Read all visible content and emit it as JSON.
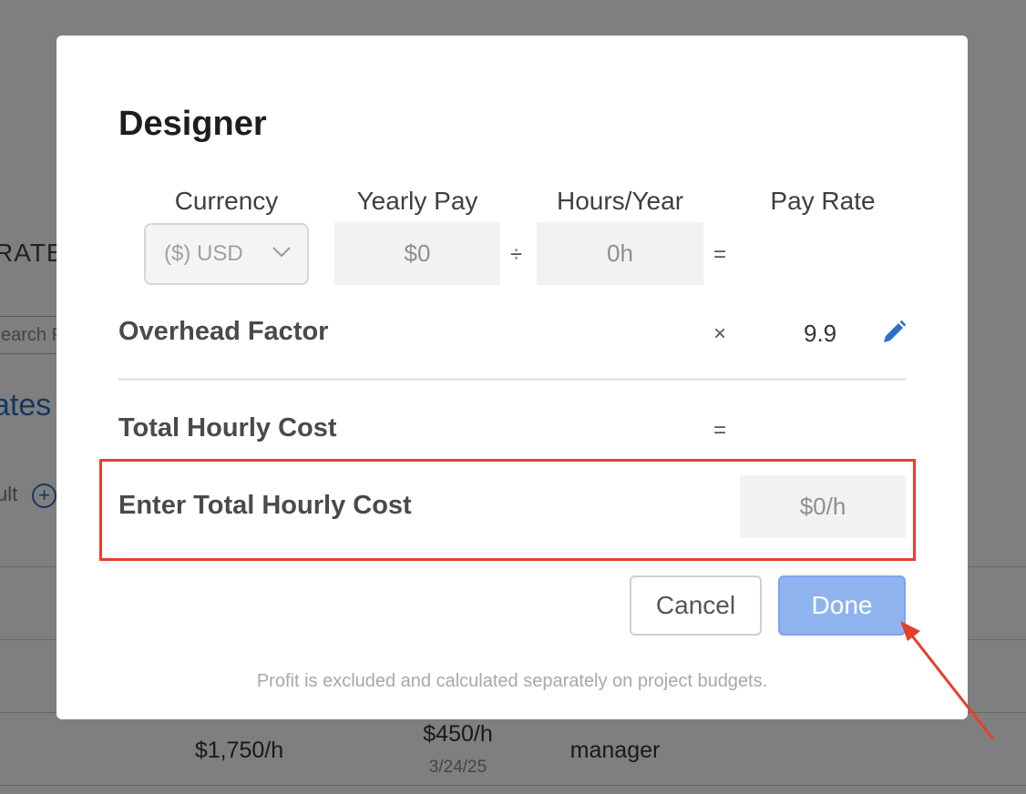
{
  "background": {
    "section_fragment": "RATE",
    "search_fragment": "earch F",
    "rates_link_fragment": "ates",
    "default_fragment": "ult",
    "table_row": {
      "rate": "$1,750/h",
      "cost": "$450/h",
      "cost_date": "3/24/25",
      "role": "manager"
    }
  },
  "modal": {
    "title": "Designer",
    "columns": {
      "currency": "Currency",
      "yearly_pay": "Yearly Pay",
      "hours_year": "Hours/Year",
      "pay_rate": "Pay Rate"
    },
    "currency_value": "($) USD",
    "yearly_pay_value": "$0",
    "hours_year_value": "0h",
    "divide_symbol": "÷",
    "equals_symbol": "=",
    "times_symbol": "×",
    "overhead_label": "Overhead Factor",
    "overhead_value": "9.9",
    "total_label": "Total Hourly Cost",
    "enter_total_label": "Enter Total Hourly Cost",
    "enter_total_placeholder": "$0/h",
    "cancel_label": "Cancel",
    "done_label": "Done",
    "footnote": "Profit is excluded and calculated separately on project budgets."
  },
  "colors": {
    "accent_blue": "#2d6fc4",
    "done_button": "#8fb3ef",
    "highlight_red": "#e53f2b"
  },
  "icons": [
    "chevron-down-icon",
    "pencil-icon",
    "plus-circle-icon",
    "arrow-annotation"
  ]
}
